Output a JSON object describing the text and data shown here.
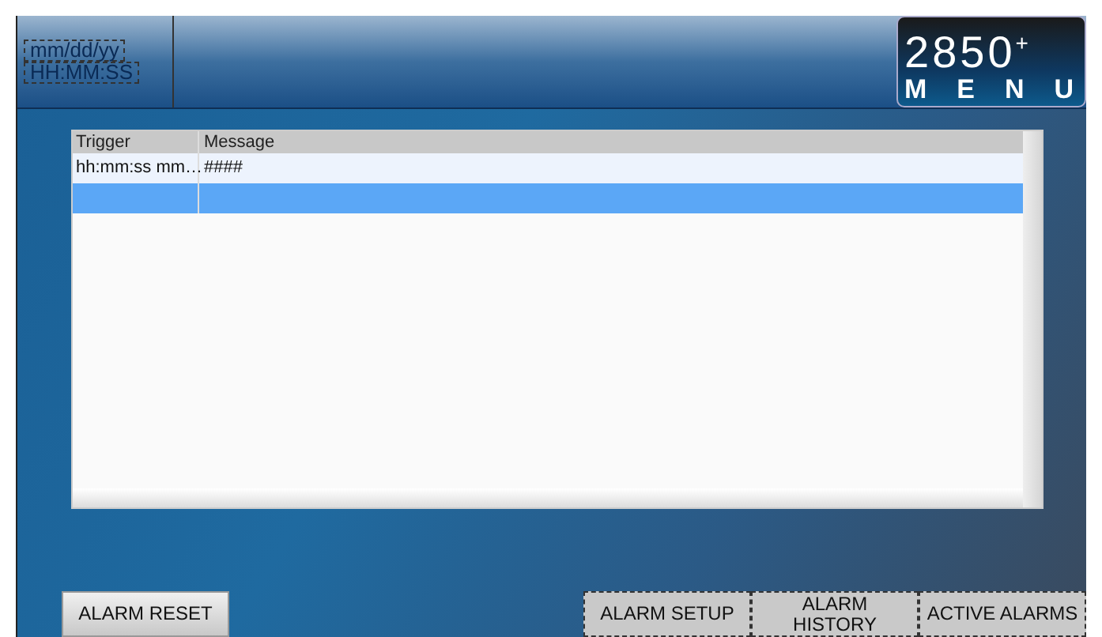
{
  "header": {
    "date": "mm/dd/yy",
    "time": "HH:MM:SS",
    "menu_logo": {
      "number": "2850",
      "plus": "+",
      "label": "MENU"
    }
  },
  "alarm_table": {
    "columns": [
      "Trigger",
      "Message"
    ],
    "rows": [
      {
        "trigger": "hh:mm:ss mm…",
        "message": "####",
        "selected": false
      },
      {
        "selected": true
      }
    ]
  },
  "left_buttons": [
    {
      "label": "ALARM RESET"
    }
  ],
  "right_buttons": [
    {
      "label": "ALARM SETUP"
    },
    {
      "label": "ALARM HISTORY"
    },
    {
      "label": "ACTIVE ALARMS"
    }
  ]
}
